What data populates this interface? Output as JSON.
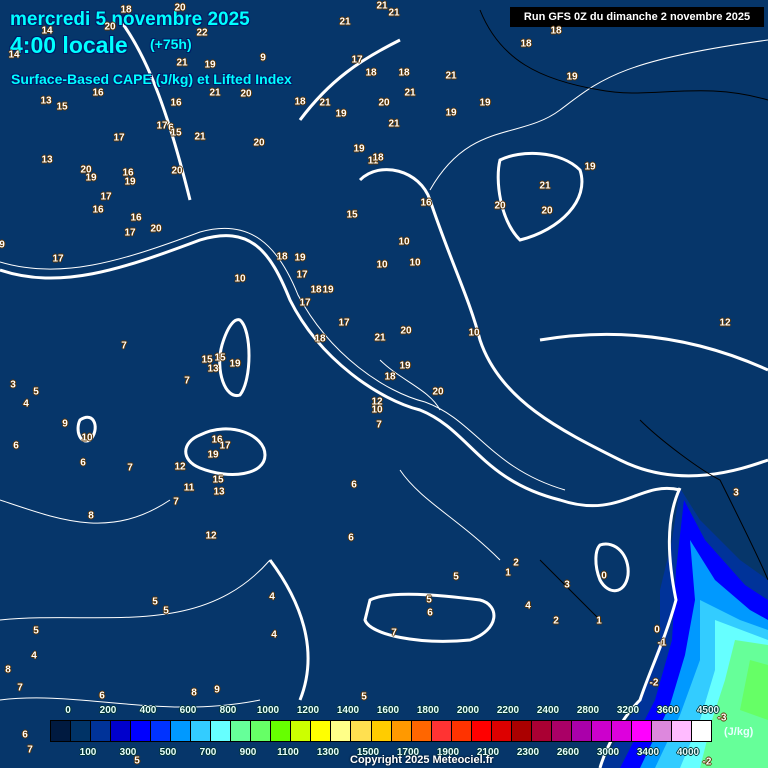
{
  "header": {
    "date": "mercredi 5 novembre 2025",
    "time": "4:00 locale",
    "offset": "(+75h)",
    "parameter": "Surface-Based CAPE (J/kg) et Lifted Index",
    "run": "Run GFS 0Z du dimanche 2 novembre 2025"
  },
  "colors": {
    "background": "#06366a",
    "title": "#00ffff",
    "scale": [
      "#001a40",
      "#003366",
      "#003399",
      "#0000cc",
      "#0000ff",
      "#0033ff",
      "#0099ff",
      "#33ccff",
      "#66ffff",
      "#66ff99",
      "#66ff66",
      "#66ff00",
      "#ccff00",
      "#ffff00",
      "#ffff88",
      "#ffe050",
      "#ffcc00",
      "#ff9900",
      "#ff6600",
      "#ff3333",
      "#ff3300",
      "#ff0000",
      "#dd0000",
      "#aa0000",
      "#aa0033",
      "#aa0066",
      "#aa00aa",
      "#cc00cc",
      "#dd00dd",
      "#ff00ff",
      "#dd88dd",
      "#ffbbff",
      "#ffffff"
    ]
  },
  "legend": {
    "top_ticks": [
      "0",
      "200",
      "400",
      "600",
      "800",
      "1000",
      "1200",
      "1400",
      "1600",
      "1800",
      "2000",
      "2200",
      "2400",
      "2800",
      "3200",
      "3600",
      "4500"
    ],
    "bottom_ticks": [
      "100",
      "300",
      "500",
      "700",
      "900",
      "1100",
      "1300",
      "1500",
      "1700",
      "1900",
      "2100",
      "2300",
      "2600",
      "3000",
      "3400",
      "4000"
    ],
    "unit": "(J/kg)"
  },
  "lifted_index_labels": [
    "18",
    "20",
    "14",
    "14",
    "22",
    "21",
    "9",
    "20",
    "21",
    "21",
    "21",
    "17",
    "18",
    "18",
    "21",
    "21",
    "20",
    "19",
    "21",
    "18",
    "20",
    "21",
    "19",
    "16",
    "13",
    "15",
    "16",
    "17",
    "6",
    "15",
    "21",
    "17",
    "13",
    "20",
    "19",
    "16",
    "19",
    "20",
    "20",
    "19",
    "11",
    "18",
    "17",
    "16",
    "16",
    "17",
    "20",
    "9",
    "17",
    "15",
    "16",
    "20",
    "21",
    "20",
    "19",
    "19",
    "18",
    "18",
    "19",
    "19",
    "21",
    "10",
    "10",
    "10",
    "18",
    "19",
    "17",
    "10",
    "18",
    "19",
    "17",
    "17",
    "20",
    "21",
    "10",
    "12",
    "18",
    "19",
    "18",
    "20",
    "12",
    "10",
    "7",
    "15",
    "15",
    "19",
    "13",
    "7",
    "7",
    "3",
    "4",
    "5",
    "9",
    "10",
    "6",
    "6",
    "7",
    "16",
    "17",
    "19",
    "12",
    "11",
    "15",
    "13",
    "7",
    "8",
    "6",
    "6",
    "12",
    "3",
    "5",
    "2",
    "1",
    "3",
    "0",
    "5",
    "6",
    "4",
    "2",
    "1",
    "4",
    "5",
    "5",
    "4",
    "7",
    "5",
    "4",
    "8",
    "7",
    "6",
    "8",
    "9",
    "5",
    "0",
    "-1",
    "-2",
    "-3",
    "-2",
    "6",
    "7",
    "5"
  ],
  "copyright": "Copyright 2025 Meteociel.fr"
}
